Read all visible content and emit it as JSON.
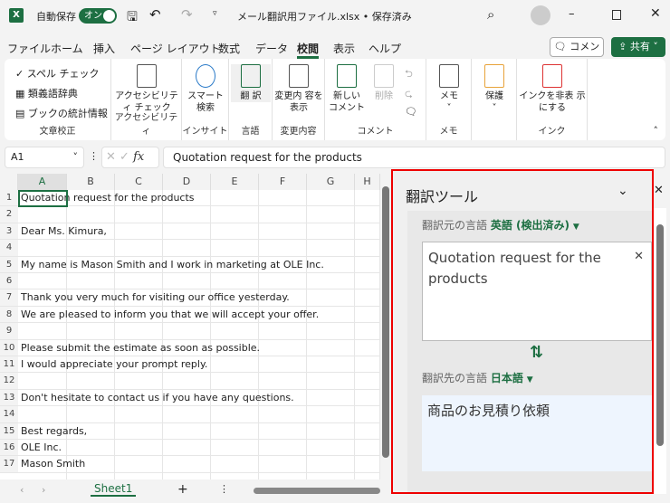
{
  "titlebar": {
    "app_icon": "X",
    "autosave_label": "自動保存",
    "autosave_state": "オン",
    "filename": "メール翻訳用ファイル.xlsx • 保存済み",
    "icons": [
      "save-icon",
      "undo-icon",
      "redo-icon",
      "customize-icon",
      "search-icon",
      "avatar",
      "minimize-icon",
      "maximize-icon",
      "close-icon"
    ]
  },
  "menu": {
    "tabs": [
      "ファイル",
      "ホーム",
      "挿入",
      "ページ レイアウト",
      "数式",
      "データ",
      "校閲",
      "表示",
      "ヘルプ"
    ],
    "active": "校閲",
    "comment_button": "コメント",
    "share_button": "共有"
  },
  "ribbon": {
    "proofing": {
      "items": [
        "スペル チェック",
        "類義語辞典",
        "ブックの統計情報"
      ],
      "label": "文章校正"
    },
    "accessibility": {
      "button": "アクセシビリティ チェック",
      "label": "アクセシビリティ"
    },
    "insights": {
      "button": "スマート 検索",
      "label": "インサイト"
    },
    "language": {
      "button": "翻 訳",
      "label": "言語"
    },
    "changes": {
      "button": "変更内 容を表示",
      "label": "変更内容"
    },
    "comments": {
      "new": "新しい コメント",
      "delete": "削除",
      "label": "コメント"
    },
    "notes": {
      "button": "メモ",
      "label": "メモ"
    },
    "protect": {
      "button": "保護",
      "label": ""
    },
    "ink": {
      "button": "インクを非表 示にする",
      "label": "インク"
    }
  },
  "formula": {
    "namebox": "A1",
    "fx": "fx",
    "value": "Quotation request for the products"
  },
  "grid": {
    "columns": [
      "A",
      "B",
      "C",
      "D",
      "E",
      "F",
      "G",
      "H"
    ],
    "rows": [
      {
        "n": "1",
        "t": "Quotation request for the products"
      },
      {
        "n": "2",
        "t": ""
      },
      {
        "n": "3",
        "t": "Dear Ms. Kimura,"
      },
      {
        "n": "4",
        "t": ""
      },
      {
        "n": "5",
        "t": "My name is Mason Smith and I work in marketing at OLE Inc."
      },
      {
        "n": "6",
        "t": ""
      },
      {
        "n": "7",
        "t": "Thank you very much for visiting our office yesterday."
      },
      {
        "n": "8",
        "t": "We are pleased to inform you that we will accept your offer."
      },
      {
        "n": "9",
        "t": ""
      },
      {
        "n": "10",
        "t": "Please submit the estimate as soon as possible."
      },
      {
        "n": "11",
        "t": "I would appreciate your prompt reply."
      },
      {
        "n": "12",
        "t": ""
      },
      {
        "n": "13",
        "t": "Don't hesitate to contact us if you have any questions."
      },
      {
        "n": "14",
        "t": ""
      },
      {
        "n": "15",
        "t": "Best regards,"
      },
      {
        "n": "16",
        "t": "OLE Inc."
      },
      {
        "n": "17",
        "t": "Mason Smith"
      }
    ]
  },
  "sheets": {
    "tabs": [
      "Sheet1"
    ],
    "add": "+"
  },
  "translator": {
    "title": "翻訳ツール",
    "source_label": "翻訳元の言語",
    "source_lang": "英語 (検出済み)",
    "source_text": "Quotation request for the products",
    "target_label": "翻訳先の言語",
    "target_lang": "日本語",
    "target_text": "商品のお見積り依頼",
    "swap": "⇅"
  },
  "colors": {
    "accent": "#1d6f42",
    "highlight_border": "#e00000"
  }
}
